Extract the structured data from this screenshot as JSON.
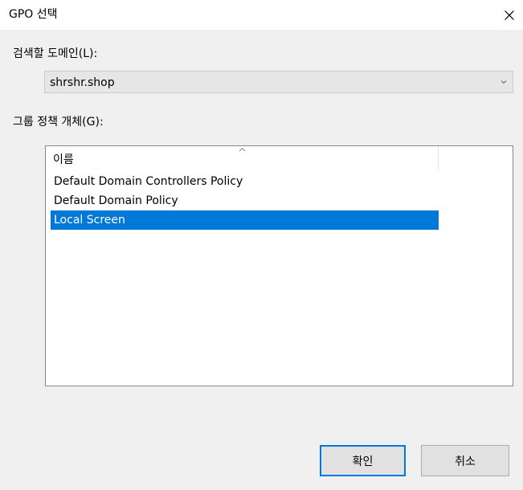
{
  "window": {
    "title": "GPO 선택"
  },
  "domain": {
    "label": "검색할 도메인(L):",
    "selected": "shrshr.shop"
  },
  "gpo": {
    "label": "그룹 정책 개체(G):",
    "column_header": "이름",
    "items": [
      {
        "label": "Default Domain Controllers Policy",
        "selected": false
      },
      {
        "label": "Default Domain Policy",
        "selected": false
      },
      {
        "label": "Local Screen",
        "selected": true
      }
    ]
  },
  "buttons": {
    "ok": "확인",
    "cancel": "취소"
  },
  "colors": {
    "selection": "#0078d7",
    "background": "#f0f0f0"
  },
  "icons": {
    "close": "close-icon",
    "dropdown": "chevron-down-icon",
    "sort": "sort-ascending-icon"
  }
}
